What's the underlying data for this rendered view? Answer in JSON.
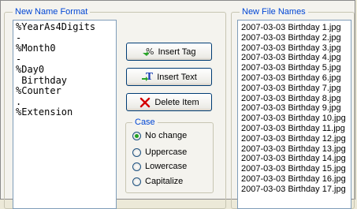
{
  "format_group": {
    "title": "New Name Format",
    "lines": [
      "%YearAs4Digits",
      "-",
      "%Month0",
      "-",
      "%Day0",
      " Birthday",
      "%Counter",
      ".",
      "%Extension"
    ]
  },
  "buttons": {
    "insert_tag": "Insert Tag",
    "insert_text": "Insert Text",
    "delete_item": "Delete Item"
  },
  "case_group": {
    "title": "Case",
    "options": [
      "No change",
      "Uppercase",
      "Lowercase",
      "Capitalize"
    ],
    "selected": "No change"
  },
  "names_group": {
    "title": "New File Names",
    "items": [
      "2007-03-03 Birthday 1.jpg",
      "2007-03-03 Birthday 2.jpg",
      "2007-03-03 Birthday 3.jpg",
      "2007-03-03 Birthday 4.jpg",
      "2007-03-03 Birthday 5.jpg",
      "2007-03-03 Birthday 6.jpg",
      "2007-03-03 Birthday 7.jpg",
      "2007-03-03 Birthday 8.jpg",
      "2007-03-03 Birthday 9.jpg",
      "2007-03-03 Birthday 10.jpg",
      "2007-03-03 Birthday 11.jpg",
      "2007-03-03 Birthday 12.jpg",
      "2007-03-03 Birthday 13.jpg",
      "2007-03-03 Birthday 14.jpg",
      "2007-03-03 Birthday 15.jpg",
      "2007-03-03 Birthday 16.jpg",
      "2007-03-03 Birthday 17.jpg"
    ]
  },
  "colors": {
    "group_title": "#0046d5",
    "selected_radio": "#21a121",
    "delete_icon": "#d40000"
  },
  "icons": {
    "insert_tag": "percent-arrow-icon",
    "insert_text": "text-arrow-icon",
    "delete_item": "red-x-icon"
  }
}
